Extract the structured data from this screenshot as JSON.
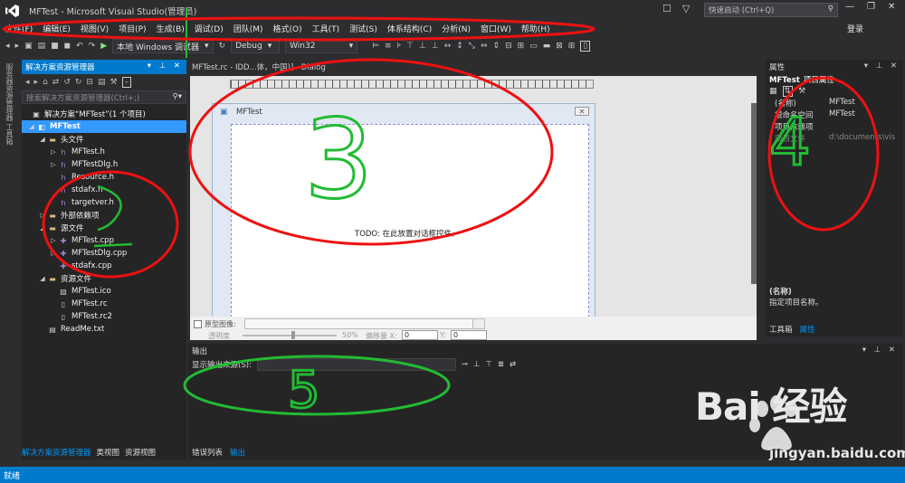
{
  "title": "MFTest - Microsoft Visual Studio(管理员)",
  "quick_launch": "快速启动 (Ctrl+Q)",
  "login": "登录",
  "menu": [
    "文件(F)",
    "编辑(E)",
    "视图(V)",
    "项目(P)",
    "生成(B)",
    "调试(D)",
    "团队(M)",
    "格式(O)",
    "工具(T)",
    "测试(S)",
    "体系结构(C)",
    "分析(N)",
    "窗口(W)",
    "帮助(H)"
  ],
  "toolbar": {
    "debugger": "本地 Windows 调试器",
    "config": "Debug",
    "platform": "Win32"
  },
  "left_strip": "服务器资源管理器  工具箱",
  "solution": {
    "header": "解决方案资源管理器",
    "search": "搜索解决方案资源管理器(Ctrl+;)",
    "items": [
      {
        "label": "解决方案“MFTest”(1 个项目)",
        "icon": "solution-icon"
      },
      {
        "label": "MFTest",
        "icon": "project-icon"
      },
      {
        "label": "头文件",
        "icon": "folder-icon"
      },
      {
        "label": "MFTest.h",
        "icon": "header-file-icon"
      },
      {
        "label": "MFTestDlg.h",
        "icon": "header-file-icon"
      },
      {
        "label": "Resource.h",
        "icon": "header-file-icon"
      },
      {
        "label": "stdafx.h",
        "icon": "header-file-icon"
      },
      {
        "label": "targetver.h",
        "icon": "header-file-icon"
      },
      {
        "label": "外部依赖项",
        "icon": "folder-icon"
      },
      {
        "label": "源文件",
        "icon": "folder-icon"
      },
      {
        "label": "MFTest.cpp",
        "icon": "cpp-file-icon"
      },
      {
        "label": "MFTestDlg.cpp",
        "icon": "cpp-file-icon"
      },
      {
        "label": "stdafx.cpp",
        "icon": "cpp-file-icon"
      },
      {
        "label": "资源文件",
        "icon": "folder-icon"
      },
      {
        "label": "MFTest.ico",
        "icon": "image-file-icon"
      },
      {
        "label": "MFTest.rc",
        "icon": "resource-file-icon"
      },
      {
        "label": "MFTest.rc2",
        "icon": "resource-file-icon"
      },
      {
        "label": "ReadMe.txt",
        "icon": "text-file-icon"
      }
    ]
  },
  "left_tabs": [
    "解决方案资源管理器",
    "类视图",
    "资源视图"
  ],
  "editor": {
    "tab": "MFTest.rc - IDD...体，中国)] - Dialog",
    "dialog_title": "MFTest",
    "todo": "TODO:  在此放置对话框控件。",
    "proto_label": "原型图像:",
    "opacity_label": "透明度",
    "opacity_value": "50%",
    "offset_label": "偏移量 X:",
    "x_value": "0",
    "y_label": "Y:",
    "y_value": "0"
  },
  "props": {
    "header": "属性",
    "object": "MFTest",
    "object_type": "项目属性",
    "rows": [
      {
        "k": "(名称)",
        "v": "MFTest"
      },
      {
        "k": "根命名空间",
        "v": "MFTest"
      },
      {
        "k": "项目依赖项",
        "v": ""
      },
      {
        "k": "项目文件",
        "v": "d:\\documents\\vis"
      }
    ],
    "desc_title": "(名称)",
    "desc_text": "指定项目名称。",
    "tabs": [
      "工具箱",
      "属性"
    ]
  },
  "output": {
    "header": "输出",
    "source_label": "显示输出来源(S):"
  },
  "bottom_tabs": [
    "错误列表",
    "输出"
  ],
  "status": "就绪",
  "watermark": {
    "brand": "Bai  经验",
    "url": "jingyan.baidu.com"
  },
  "annotations": [
    "3",
    "4",
    "5"
  ]
}
